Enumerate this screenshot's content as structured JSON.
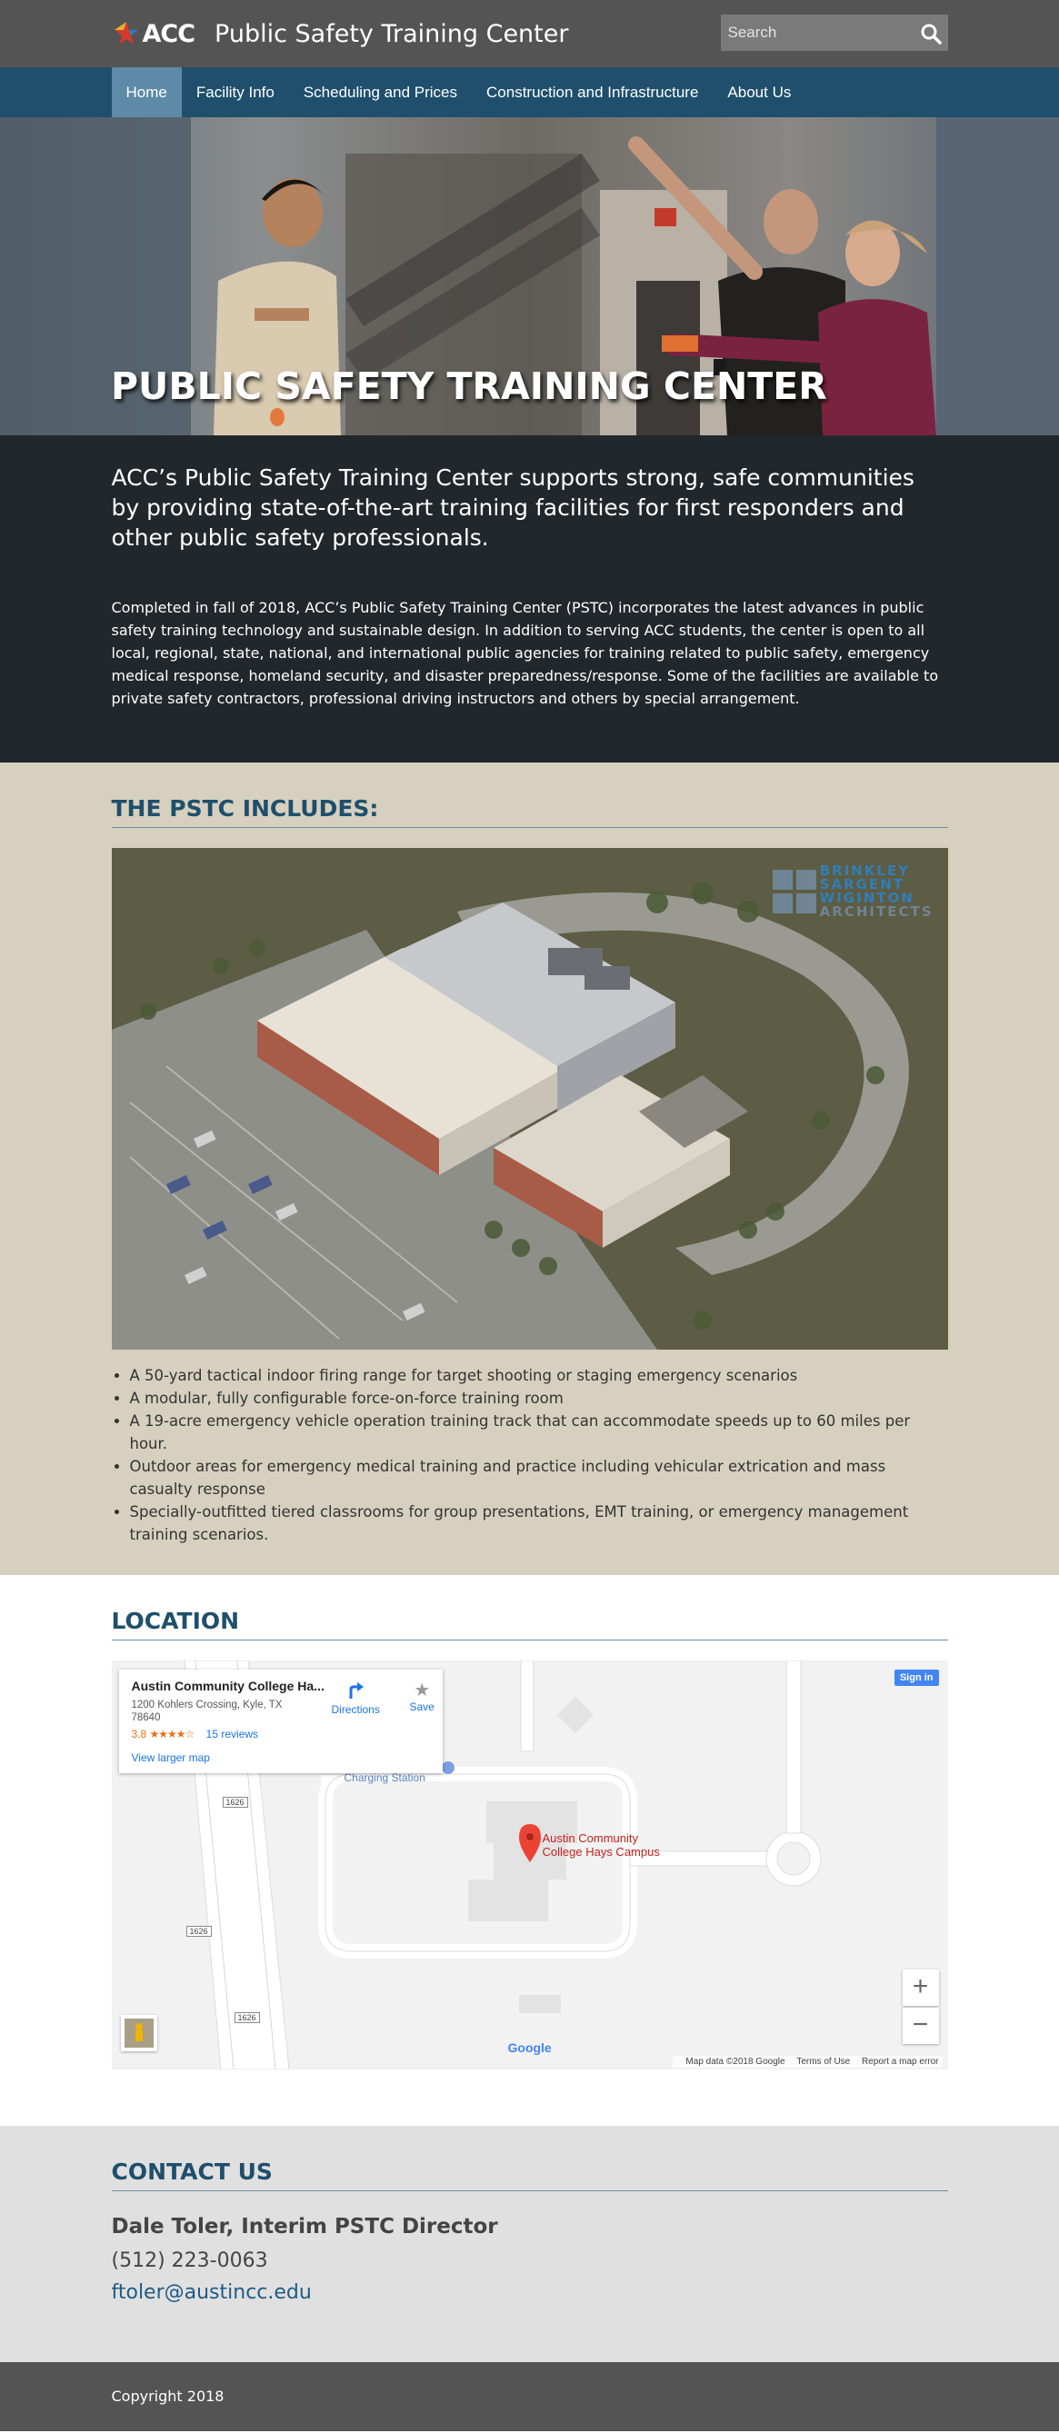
{
  "header": {
    "logo_text": "ACC",
    "site_title": "Public Safety Training Center",
    "search_placeholder": "Search"
  },
  "nav": {
    "items": [
      {
        "label": "Home",
        "active": true
      },
      {
        "label": "Facility Info",
        "active": false
      },
      {
        "label": "Scheduling and Prices",
        "active": false
      },
      {
        "label": "Construction and Infrastructure",
        "active": false
      },
      {
        "label": "About Us",
        "active": false
      }
    ]
  },
  "hero": {
    "title": "PUBLIC SAFETY TRAINING CENTER"
  },
  "intro": {
    "lead": "ACC’s Public Safety Training Center supports strong, safe communities by providing state-of-the-art training facilities for first responders and other public safety professionals.",
    "body": "Completed in fall of 2018, ACC’s Public Safety Training Center (PSTC) incorporates the latest advances in public safety training technology and sustainable design. In addition to serving ACC students, the center is open to all local, regional, state, national, and international public agencies for training related to public safety, emergency medical response, homeland security, and disaster preparedness/response. Some of the facilities are available to private safety contractors, professional driving instructors and others by special arrangement."
  },
  "includes": {
    "heading": "THE PSTC INCLUDES:",
    "architect_logo": [
      "BRINKLEY",
      "SARGENT",
      "WIGINTON",
      "ARCHITECTS"
    ],
    "features": [
      "A 50-yard tactical indoor firing range for target shooting or staging emergency scenarios",
      "A modular, fully configurable force-on-force training room",
      "A 19-acre emergency vehicle operation training track that can accommodate speeds up to 60 miles per hour.",
      "Outdoor areas for emergency medical training and practice including vehicular extrication and mass casualty response",
      "Specially-outfitted tiered classrooms for group presentations, EMT training, or emergency management training scenarios."
    ]
  },
  "location": {
    "heading": "LOCATION",
    "map": {
      "place_name": "Austin Community College Ha...",
      "address": "1200 Kohlers Crossing, Kyle, TX 78640",
      "rating": "3.8",
      "stars": "★★★★☆",
      "reviews": "15 reviews",
      "view_larger": "View larger map",
      "directions": "Directions",
      "save": "Save",
      "sign_in": "Sign in",
      "charging_label": "Charging Station",
      "campus_label_1": "Austin Community",
      "campus_label_2": "College Hays Campus",
      "road_label": "1626",
      "zoom_in": "+",
      "zoom_out": "−",
      "google": "Google",
      "map_data": "Map data ©2018 Google",
      "terms": "Terms of Use",
      "report": "Report a map error"
    }
  },
  "contact": {
    "heading": "CONTACT US",
    "name": "Dale Toler, Interim PSTC Director",
    "phone": "(512) 223-0063",
    "email": "ftoler@austincc.edu"
  },
  "footer": {
    "copyright": "Copyright 2018"
  },
  "colors": {
    "header_bg": "#545454",
    "nav_bg": "#1f4f6c",
    "nav_active": "#5d8aa6",
    "intro_bg": "#22272c",
    "includes_bg": "#d7d0bf",
    "heading": "#1f4f6c",
    "contact_bg": "#e0e0e0",
    "link": "#1f5b85"
  }
}
